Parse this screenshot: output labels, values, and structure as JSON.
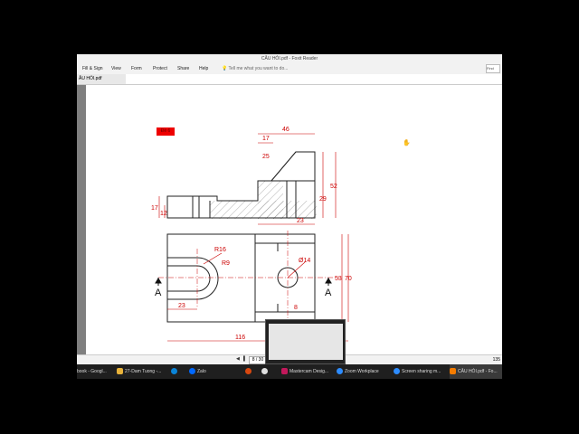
{
  "window": {
    "title": "CÂU HỎI.pdf - Foxit Reader"
  },
  "ribbon": {
    "menus": [
      "Fill & Sign",
      "View",
      "Form",
      "Protect",
      "Share",
      "Help"
    ],
    "tell_me": "Tell me what you want to do...",
    "find": "Find"
  },
  "tab": {
    "label": "ÂU HỎI.pdf"
  },
  "page_tag": "Đề 6",
  "drawing": {
    "dims": {
      "d46": "46",
      "d17top": "17",
      "d25": "25",
      "d29": "29",
      "d52": "52",
      "d17": "17",
      "d12": "12",
      "d23top": "23",
      "r16": "R16",
      "r9": "R9",
      "d14": "Ø14",
      "d53": "53",
      "d70": "70",
      "d23bot": "23",
      "d8": "8",
      "d116": "116"
    },
    "section_left": "A",
    "section_right": "A"
  },
  "status": {
    "page": "8 / 30",
    "zoom": "135"
  },
  "taskbar": {
    "items": [
      {
        "label": "book - Googl...",
        "color": "#4285f4"
      },
      {
        "label": "27-Dam Tuong -...",
        "color": "#e8b23a"
      },
      {
        "label": "",
        "color": "#0a84d8"
      },
      {
        "label": "Zalo",
        "color": "#0068ff"
      },
      {
        "label": "",
        "color": "#d9480f"
      },
      {
        "label": "",
        "color": "#e0e0e0"
      },
      {
        "label": "Mastercam Desig...",
        "color": "#c2185b"
      },
      {
        "label": "Zoom Workplace",
        "color": "#2d8cff"
      },
      {
        "label": "Screen sharing m...",
        "color": "#2d8cff"
      },
      {
        "label": "CÂU HỎI.pdf - Fo...",
        "color": "#f57c00"
      }
    ]
  }
}
